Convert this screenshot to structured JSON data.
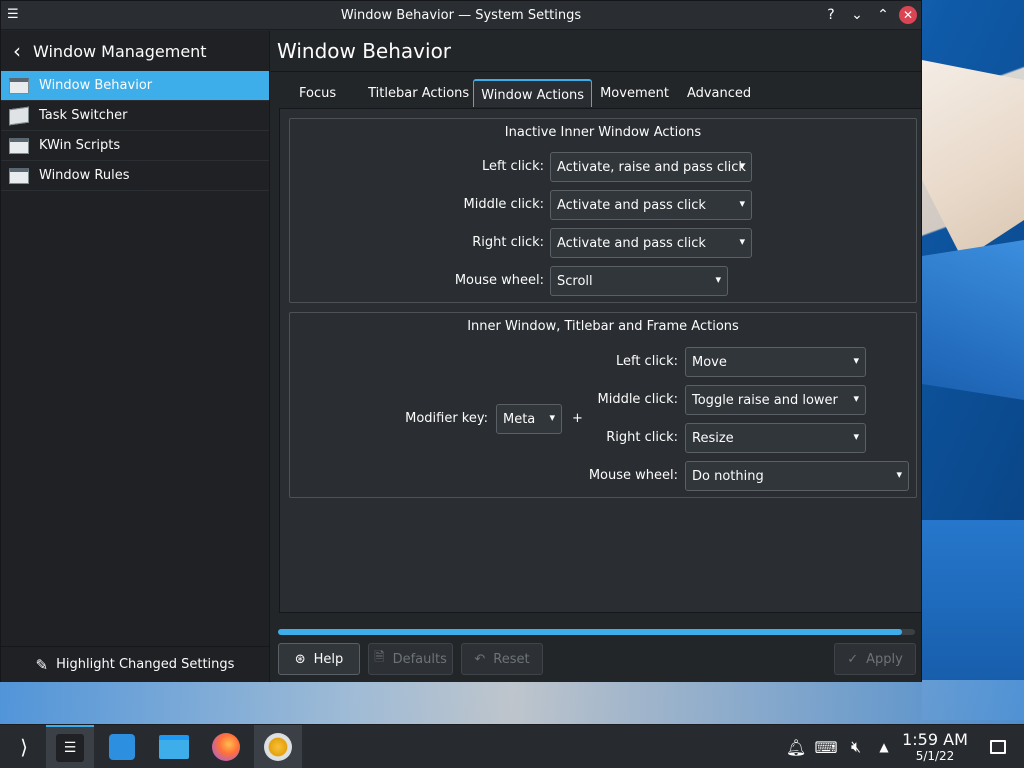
{
  "window": {
    "title": "Window Behavior — System Settings",
    "help_glyph": "?",
    "minimize_glyph": "⌄",
    "maximize_glyph": "⌃",
    "close_glyph": "✕"
  },
  "sidebar": {
    "header": "Window Management",
    "items": [
      {
        "label": "Window Behavior",
        "icon": "window-icon",
        "active": true
      },
      {
        "label": "Task Switcher",
        "icon": "task-switcher-icon",
        "active": false
      },
      {
        "label": "KWin Scripts",
        "icon": "window-icon",
        "active": false
      },
      {
        "label": "Window Rules",
        "icon": "window-icon",
        "active": false
      }
    ],
    "footer": "Highlight Changed Settings"
  },
  "main": {
    "title": "Window Behavior",
    "tabs": [
      "Focus",
      "Titlebar Actions",
      "Window Actions",
      "Movement",
      "Advanced"
    ],
    "active_tab": "Window Actions",
    "inactive_group": {
      "title": "Inactive Inner Window Actions",
      "rows": [
        {
          "label": "Left click:",
          "value": "Activate, raise and pass click"
        },
        {
          "label": "Middle click:",
          "value": "Activate and pass click"
        },
        {
          "label": "Right click:",
          "value": "Activate and pass click"
        },
        {
          "label": "Mouse wheel:",
          "value": "Scroll"
        }
      ]
    },
    "frame_group": {
      "title": "Inner Window, Titlebar and Frame Actions",
      "modifier_label": "Modifier key:",
      "modifier_value": "Meta",
      "plus": "+",
      "rows": [
        {
          "label": "Left click:",
          "value": "Move"
        },
        {
          "label": "Middle click:",
          "value": "Toggle raise and lower"
        },
        {
          "label": "Right click:",
          "value": "Resize"
        },
        {
          "label": "Mouse wheel:",
          "value": "Do nothing"
        }
      ]
    },
    "progress": 0.98,
    "buttons": {
      "help": "Help",
      "defaults": "Defaults",
      "reset": "Reset",
      "apply": "Apply"
    }
  },
  "taskbar": {
    "time": "1:59 AM",
    "date": "5/1/22"
  },
  "colors": {
    "accent": "#3daee9",
    "close": "#da4453"
  }
}
